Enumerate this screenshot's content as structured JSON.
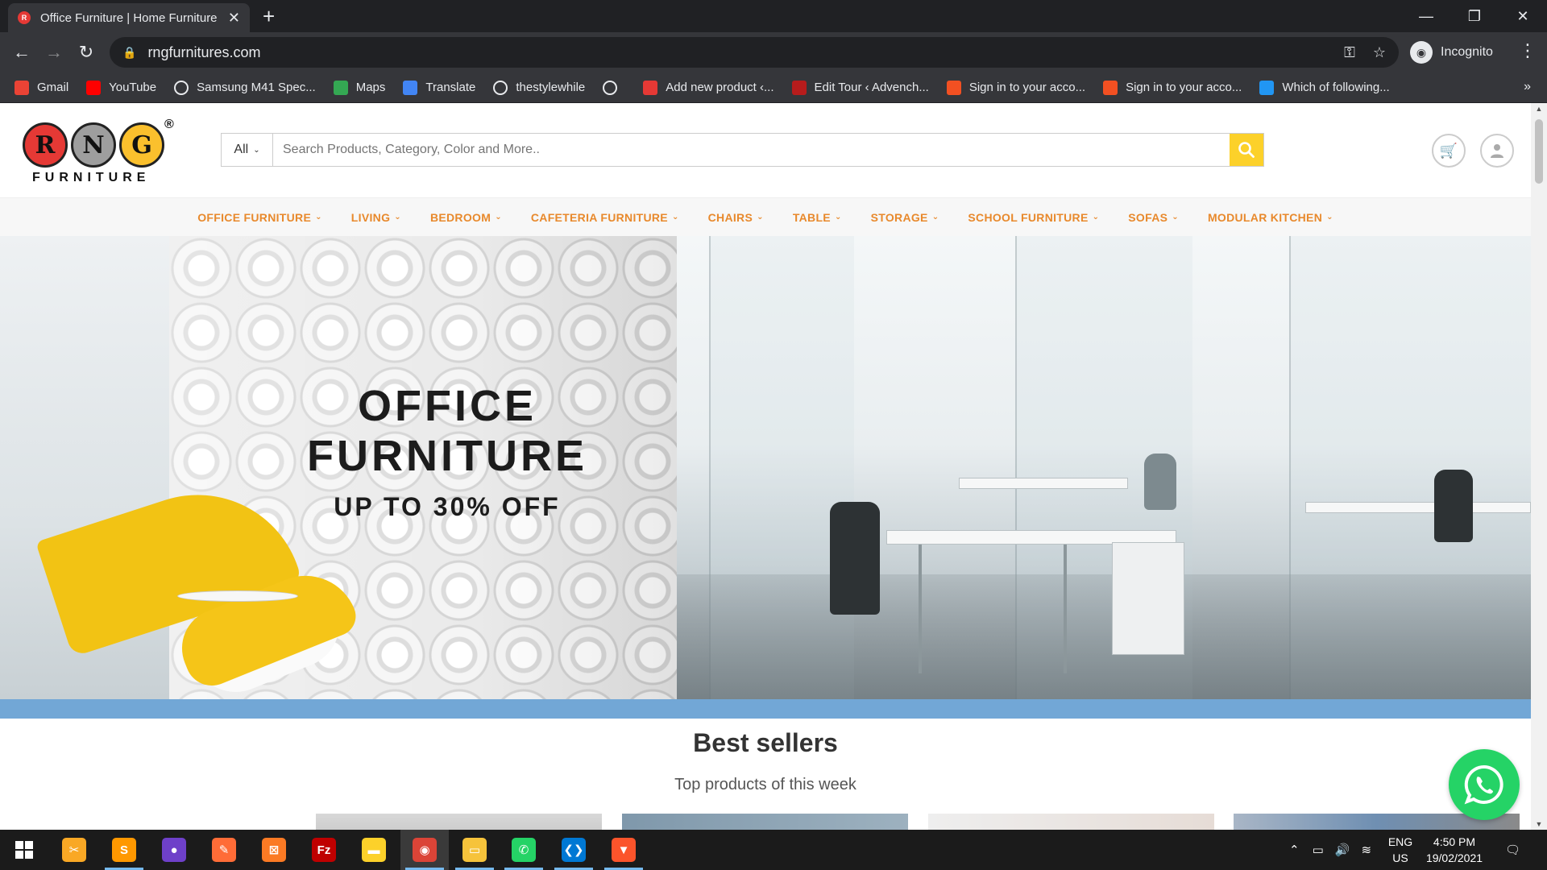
{
  "browser": {
    "tab_title": "Office Furniture | Home Furniture",
    "url": "rngfurnitures.com",
    "incognito_label": "Incognito",
    "bookmarks": [
      {
        "label": "Gmail",
        "icon": "gmail-icon",
        "color": "#ea4335"
      },
      {
        "label": "YouTube",
        "icon": "youtube-icon",
        "color": "#ff0000"
      },
      {
        "label": "Samsung M41 Spec...",
        "icon": "globe-icon",
        "color": "#e8eaed"
      },
      {
        "label": "Maps",
        "icon": "maps-icon",
        "color": "#34a853"
      },
      {
        "label": "Translate",
        "icon": "translate-icon",
        "color": "#4285f4"
      },
      {
        "label": "thestylewhile",
        "icon": "globe-icon",
        "color": "#e8eaed"
      },
      {
        "label": "",
        "icon": "globe-icon",
        "color": "#e8eaed"
      },
      {
        "label": "Add new product ‹...",
        "icon": "rng-icon",
        "color": "#e53935"
      },
      {
        "label": "Edit Tour ‹ Advench...",
        "icon": "advench-icon",
        "color": "#b71c1c"
      },
      {
        "label": "Sign in to your acco...",
        "icon": "microsoft-icon",
        "color": "#f25022"
      },
      {
        "label": "Sign in to your acco...",
        "icon": "microsoft-icon",
        "color": "#f25022"
      },
      {
        "label": "Which of following...",
        "icon": "upload-icon",
        "color": "#2196f3"
      }
    ]
  },
  "site": {
    "logo_letters": [
      "R",
      "N",
      "G"
    ],
    "logo_colors": [
      "#e53935",
      "#9e9e9e",
      "#fbc02d"
    ],
    "logo_word": "FURNITURE",
    "logo_reg": "®",
    "search_category": "All",
    "search_placeholder": "Search Products, Category, Color and More..",
    "nav": [
      "OFFICE FURNITURE",
      "LIVING",
      "BEDROOM",
      "CAFETERIA FURNITURE",
      "CHAIRS",
      "TABLE",
      "STORAGE",
      "SCHOOL FURNITURE",
      "SOFAS",
      "MODULAR KITCHEN"
    ],
    "hero": {
      "title_line1": "OFFICE",
      "title_line2": "FURNITURE",
      "offer": "UP TO 30% OFF"
    },
    "best_sellers_title": "Best sellers",
    "best_sellers_sub": "Top products of this week"
  },
  "taskbar": {
    "apps": [
      {
        "name": "snip-icon",
        "color": "#f9a825",
        "glyph": "✂"
      },
      {
        "name": "sublime-text-icon",
        "color": "#ff9800",
        "glyph": "S"
      },
      {
        "name": "github-desktop-icon",
        "color": "#6e40c9",
        "glyph": "●"
      },
      {
        "name": "postman-icon",
        "color": "#ff6c37",
        "glyph": "✎"
      },
      {
        "name": "xampp-icon",
        "color": "#fb7a24",
        "glyph": "⊠"
      },
      {
        "name": "filezilla-icon",
        "color": "#bf0000",
        "glyph": "Fz"
      },
      {
        "name": "sticky-notes-icon",
        "color": "#fcd12a",
        "glyph": "▬"
      },
      {
        "name": "chrome-icon",
        "color": "#db4437",
        "glyph": "◉"
      },
      {
        "name": "file-explorer-icon",
        "color": "#f6c33b",
        "glyph": "▭"
      },
      {
        "name": "whatsapp-icon",
        "color": "#25d366",
        "glyph": "✆"
      },
      {
        "name": "vscode-icon",
        "color": "#0078d4",
        "glyph": "❮❯"
      },
      {
        "name": "brave-icon",
        "color": "#fb542b",
        "glyph": "▼"
      }
    ],
    "lang_line1": "ENG",
    "lang_line2": "US",
    "time": "4:50 PM",
    "date": "19/02/2021"
  }
}
